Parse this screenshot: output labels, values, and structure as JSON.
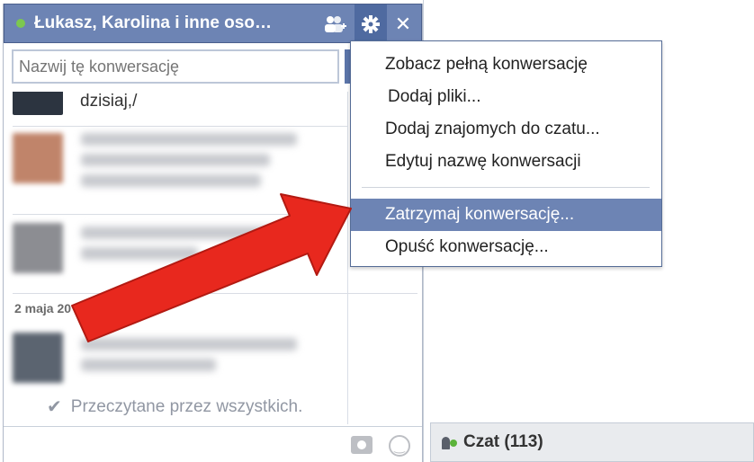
{
  "header": {
    "title": "Łukasz, Karolina i inne oso…",
    "status_color": "#7cc850"
  },
  "name_field": {
    "placeholder": "Nazwij tę konwersację"
  },
  "messages": {
    "first_text": "dzisiaj,/",
    "date_label": "2 maja 20",
    "read_receipt": "Przeczytane przez wszystkich."
  },
  "menu": {
    "items": [
      {
        "label": "Zobacz pełną konwersację"
      },
      {
        "label": "Dodaj pliki..."
      },
      {
        "label": "Dodaj znajomych do czatu..."
      },
      {
        "label": "Edytuj nazwę konwersacji"
      },
      {
        "label": "Zatrzymaj konwersację..."
      },
      {
        "label": "Opuść konwersację..."
      }
    ],
    "highlighted_index": 4,
    "highlight_color": "#6d84b4"
  },
  "chatbar": {
    "label": "Czat (113)"
  },
  "annotation": {
    "arrow_color": "#e8281e"
  }
}
